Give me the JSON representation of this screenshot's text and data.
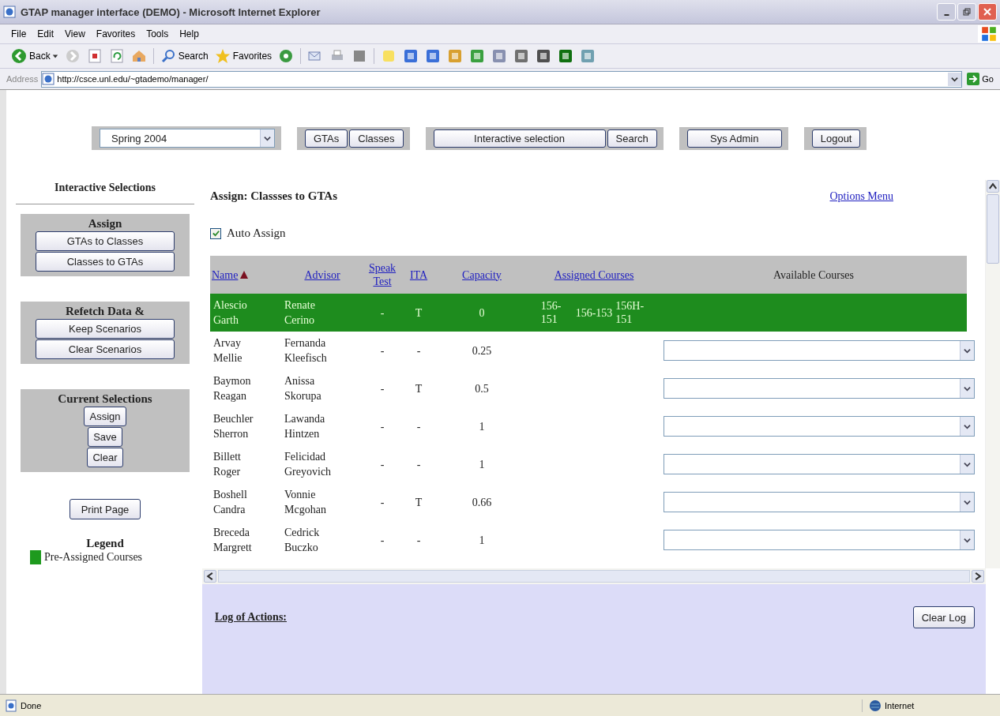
{
  "window": {
    "title": "GTAP manager interface (DEMO) - Microsoft Internet Explorer"
  },
  "menu": [
    "File",
    "Edit",
    "View",
    "Favorites",
    "Tools",
    "Help"
  ],
  "toolbar": {
    "back": "Back",
    "search": "Search",
    "favorites": "Favorites"
  },
  "address": {
    "label": "Address",
    "url": "http://csce.unl.edu/~gtademo/manager/",
    "go": "Go"
  },
  "top_bar": {
    "term": "Spring 2004",
    "groups": [
      [
        "GTAs",
        "Classes"
      ],
      [
        "Interactive selection",
        "Search"
      ],
      [
        "Sys Admin"
      ],
      [
        "Logout"
      ]
    ]
  },
  "sidebar": {
    "title": "Interactive Selections",
    "panels": [
      {
        "title": "Assign",
        "buttons": [
          "GTAs to Classes",
          "Classes to GTAs"
        ]
      },
      {
        "title": "Refetch Data &",
        "buttons": [
          "Keep Scenarios",
          "Clear Scenarios"
        ]
      },
      {
        "title": "Current Selections",
        "buttons": [
          "Assign",
          "Save",
          "Clear"
        ]
      }
    ],
    "print": "Print Page",
    "legend": {
      "title": "Legend",
      "items": [
        "Pre-Assigned Courses"
      ]
    }
  },
  "main": {
    "title": "Assign: Classses to GTAs",
    "options_link": "Options Menu",
    "auto_assign": {
      "label": "Auto Assign",
      "checked": true
    },
    "table": {
      "columns": [
        {
          "label": "Name",
          "link": true,
          "sorted": true
        },
        {
          "label": "Advisor",
          "link": true
        },
        {
          "label": "Speak Test",
          "link": true
        },
        {
          "label": "ITA",
          "link": true
        },
        {
          "label": "Capacity",
          "link": true
        },
        {
          "label": "Assigned Courses",
          "link": true
        },
        {
          "label": "Available Courses",
          "link": false
        }
      ],
      "rows": [
        {
          "name": "Alescio Garth",
          "advisor": "Renate Cerino",
          "speak_test": "-",
          "ita": "T",
          "capacity": "0",
          "pre_assigned": true,
          "assigned": [
            "156-151",
            "156-153",
            "156H-151"
          ]
        },
        {
          "name": "Arvay Mellie",
          "advisor": "Fernanda Kleefisch",
          "speak_test": "-",
          "ita": "-",
          "capacity": "0.25",
          "pre_assigned": false
        },
        {
          "name": "Baymon Reagan",
          "advisor": "Anissa Skorupa",
          "speak_test": "-",
          "ita": "T",
          "capacity": "0.5",
          "pre_assigned": false
        },
        {
          "name": "Beuchler Sherron",
          "advisor": "Lawanda Hintzen",
          "speak_test": "-",
          "ita": "-",
          "capacity": "1",
          "pre_assigned": false
        },
        {
          "name": "Billett Roger",
          "advisor": "Felicidad Greyovich",
          "speak_test": "-",
          "ita": "-",
          "capacity": "1",
          "pre_assigned": false
        },
        {
          "name": "Boshell Candra",
          "advisor": "Vonnie Mcgohan",
          "speak_test": "-",
          "ita": "T",
          "capacity": "0.66",
          "pre_assigned": false
        },
        {
          "name": "Breceda Margrett",
          "advisor": "Cedrick Buczko",
          "speak_test": "-",
          "ita": "-",
          "capacity": "1",
          "pre_assigned": false
        }
      ]
    }
  },
  "log": {
    "title": "Log of Actions:",
    "clear": "Clear Log"
  },
  "status_bar": {
    "left": "Done",
    "zone": "Internet"
  }
}
